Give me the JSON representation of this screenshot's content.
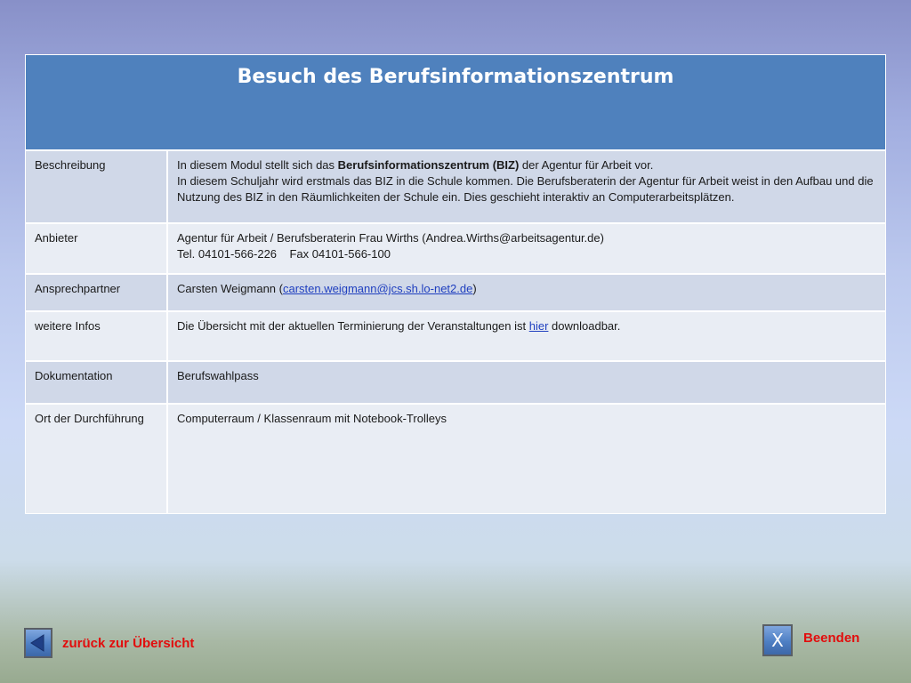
{
  "title": "Besuch des Berufsinformationszentrum",
  "rows": {
    "beschreibung": {
      "label": "Beschreibung",
      "line1_before": "In diesem Modul stellt sich das ",
      "line1_bold": "Berufsinformationszentrum (BIZ)",
      "line1_after": " der Agentur für Arbeit vor.",
      "line2": "In diesem Schuljahr wird erstmals das BIZ in die Schule kommen. Die Berufsberaterin der Agentur für Arbeit weist in den Aufbau und die Nutzung des BIZ in den Räumlichkeiten der Schule ein. Dies geschieht interaktiv an Computerarbeitsplätzen."
    },
    "anbieter": {
      "label": "Anbieter",
      "line1": "Agentur für Arbeit / Berufsberaterin Frau Wirths (Andrea.Wirths@arbeitsagentur.de)",
      "line2": "Tel. 04101-566-226    Fax 04101-566-100"
    },
    "ansprechpartner": {
      "label": "Ansprechpartner",
      "text_before": "Carsten Weigmann (",
      "email": "carsten.weigmann@jcs.sh.lo-net2.de",
      "text_after": ")"
    },
    "infos": {
      "label": "weitere Infos",
      "text_before": "Die Übersicht mit der aktuellen Terminierung der Veranstaltungen ist ",
      "link": "hier",
      "text_after": " downloadbar."
    },
    "dokumentation": {
      "label": "Dokumentation",
      "value": "Berufswahlpass"
    },
    "ort": {
      "label": "Ort der Durchführung",
      "value": "Computerraum / Klassenraum mit Notebook-Trolleys"
    }
  },
  "nav": {
    "back_label": "zurück zur Übersicht",
    "back_icon": "left-arrow-icon",
    "exit_label": "Beenden",
    "exit_icon": "x-icon",
    "exit_glyph": "X"
  },
  "colors": {
    "header": "#4f81bd",
    "row_dark": "#d0d8e8",
    "row_light": "#e9edf4",
    "nav_text": "#e20d0d",
    "link": "#1f3fbf"
  }
}
